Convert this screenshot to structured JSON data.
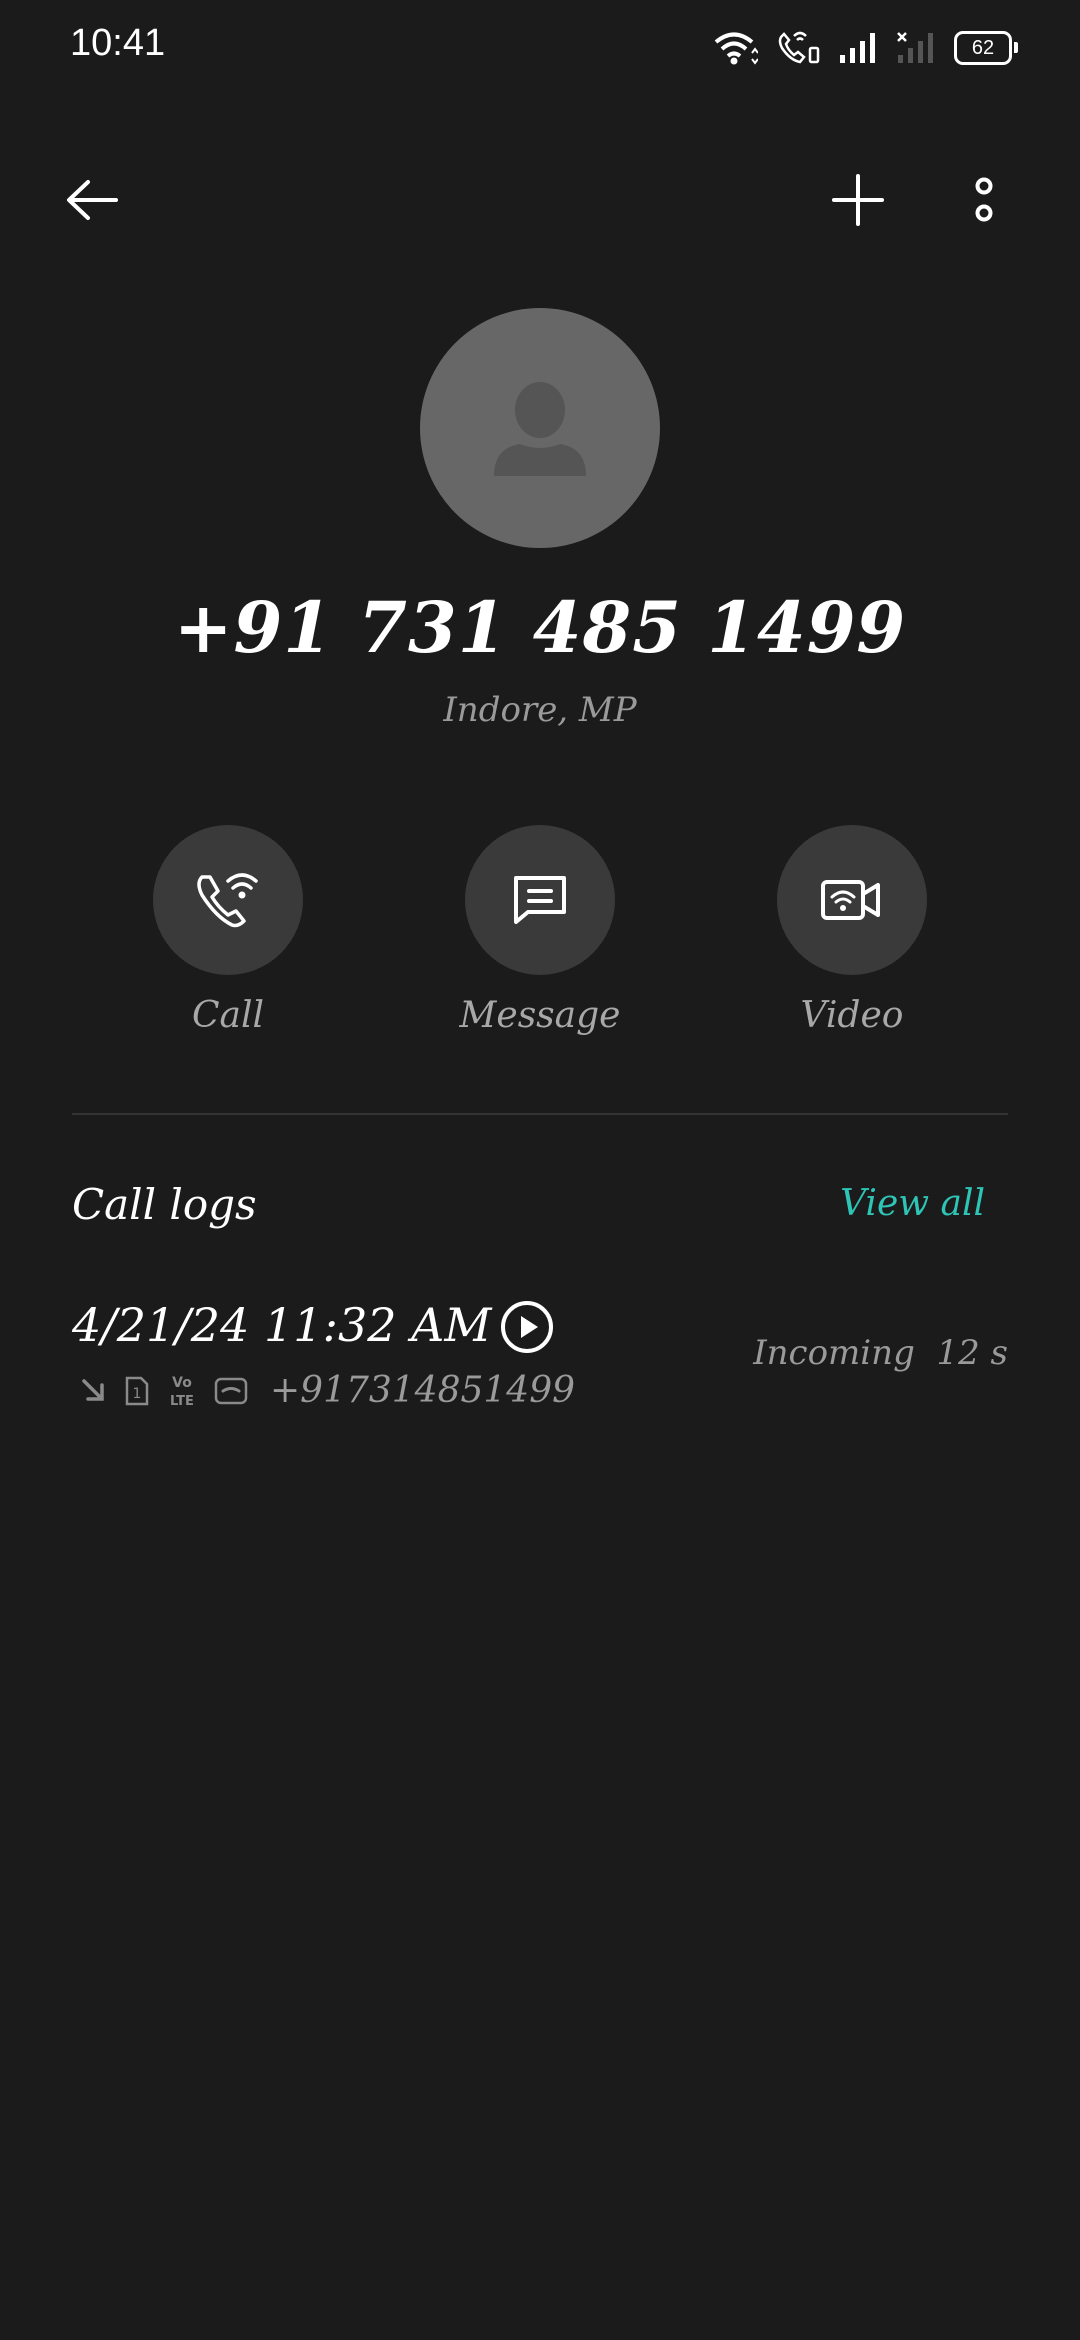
{
  "status_bar": {
    "time": "10:41",
    "battery": "62"
  },
  "contact": {
    "phone": "+91 731 485 1499",
    "location": "Indore, MP"
  },
  "actions": [
    {
      "label": "Call",
      "icon": "wifi-call-icon"
    },
    {
      "label": "Message",
      "icon": "message-icon"
    },
    {
      "label": "Video",
      "icon": "video-call-icon"
    }
  ],
  "call_logs": {
    "title": "Call logs",
    "view_all": "View all",
    "entries": [
      {
        "datetime": "4/21/24 11:32 AM",
        "number": "+917314851499",
        "direction": "Incoming",
        "duration": "12 s",
        "sim": "1",
        "network": "VoLTE"
      }
    ]
  },
  "colors": {
    "background": "#1b1b1b",
    "accent": "#2ec4b6",
    "avatar": "#676767",
    "action_bg": "#3a3a3a"
  }
}
